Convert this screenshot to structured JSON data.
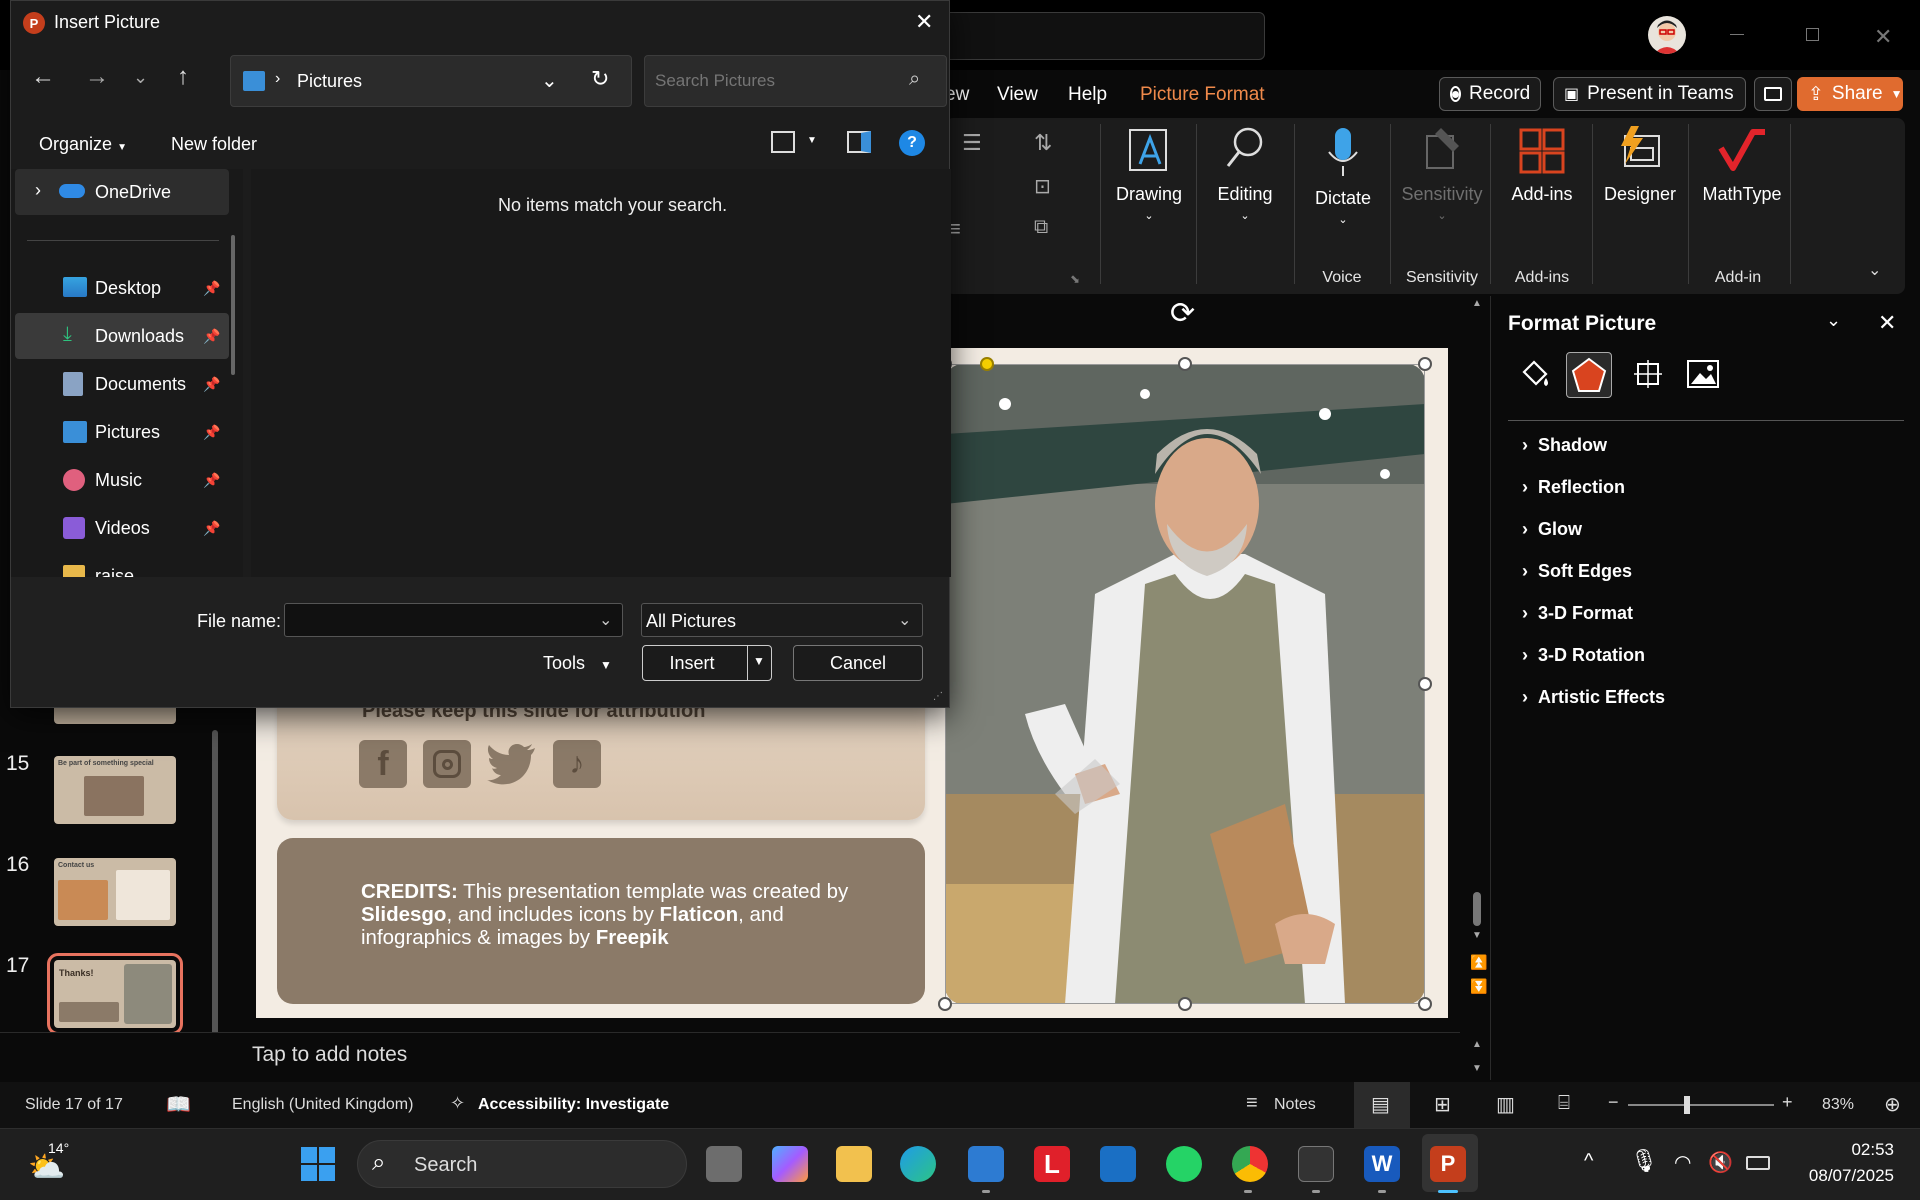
{
  "ppt": {
    "menu": [
      "ew",
      "View",
      "Help",
      "Picture Format"
    ],
    "record": "Record",
    "present_teams": "Present in Teams",
    "share": "Share",
    "ribbon": {
      "drawing": "Drawing",
      "editing": "Editing",
      "dictate": "Dictate",
      "sensitivity": "Sensitivity",
      "addins": "Add-ins",
      "designer": "Designer",
      "mathtype": "MathType",
      "groups": {
        "voice": "Voice",
        "sensitivity": "Sensitivity",
        "addins": "Add-ins",
        "addin": "Add-in"
      }
    },
    "thumbnails": [
      {
        "num": "15",
        "title": "Be part of something special"
      },
      {
        "num": "16",
        "title": "Contact us"
      },
      {
        "num": "17",
        "title": "Thanks!"
      }
    ],
    "slide": {
      "attribution": "Please keep this slide for attribution",
      "credits_label": "CREDITS:",
      "credits_text1": " This presentation template was created by ",
      "slidesgo": "Slidesgo",
      "credits_text2": ", and includes icons by ",
      "flaticon": "Flaticon",
      "credits_text3": ", and infographics & images by ",
      "freepik": "Freepik"
    },
    "notes_placeholder": "Tap to add notes",
    "status": {
      "slide": "Slide 17 of 17",
      "language": "English (United Kingdom)",
      "accessibility": "Accessibility: Investigate",
      "notes": "Notes",
      "zoom": "83%"
    },
    "format_pane": {
      "title": "Format Picture",
      "sections": [
        "Shadow",
        "Reflection",
        "Glow",
        "Soft Edges",
        "3-D Format",
        "3-D Rotation",
        "Artistic Effects"
      ]
    }
  },
  "dialog": {
    "title": "Insert Picture",
    "address": "Pictures",
    "search_placeholder": "Search Pictures",
    "organize": "Organize",
    "new_folder": "New folder",
    "onedrive": "OneDrive",
    "nav": [
      "Desktop",
      "Downloads",
      "Documents",
      "Pictures",
      "Music",
      "Videos",
      "raise"
    ],
    "empty_message": "No items match your search.",
    "file_name_label": "File name:",
    "file_name_value": "",
    "filter": "All Pictures",
    "tools": "Tools",
    "insert": "Insert",
    "cancel": "Cancel"
  },
  "taskbar": {
    "weather": "14°",
    "search": "Search",
    "time": "02:53",
    "date": "08/07/2025"
  },
  "colors": {
    "accent_orange": "#e06b2f",
    "ppt_red": "#c43e1c",
    "selection": "#e8735f"
  }
}
